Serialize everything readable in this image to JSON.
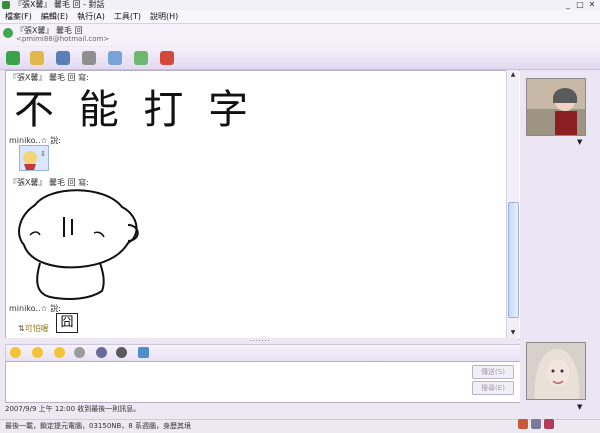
{
  "window": {
    "title": "『張X馨』  馨毛  回 - 對話"
  },
  "menu": [
    "檔案(F)",
    "編輯(E)",
    "執行(A)",
    "工具(T)",
    "說明(H)"
  ],
  "contact": {
    "name": "『張X馨』   馨毛  回",
    "email": "<pmimi88@hotmail.com>"
  },
  "toolbar_icons": [
    "invite-icon",
    "send-files-icon",
    "video-icon",
    "call-icon",
    "activities-icon",
    "games-icon",
    "block-icon"
  ],
  "chat": {
    "msg1_header": "『張X馨』    馨毛  回 寫:",
    "handwriting1": "不 能 打  字",
    "msg2_sender": "miniko..☆ 說:",
    "msg3_header": "『張X馨』    馨毛  回 寫:",
    "msg4_sender": "miniko..☆ 說:",
    "msg4_text": "可怕喔",
    "msg4_emoticon": "囧"
  },
  "send_button": "傳送(S)",
  "search_button": "搜尋(E)",
  "status_text": "2007/9/9 上午 12:00 收到最後一則訊息。",
  "bottom_text": "最後一載，鎖定提元電腦，03150NB，8 系週腦，身歷其境"
}
